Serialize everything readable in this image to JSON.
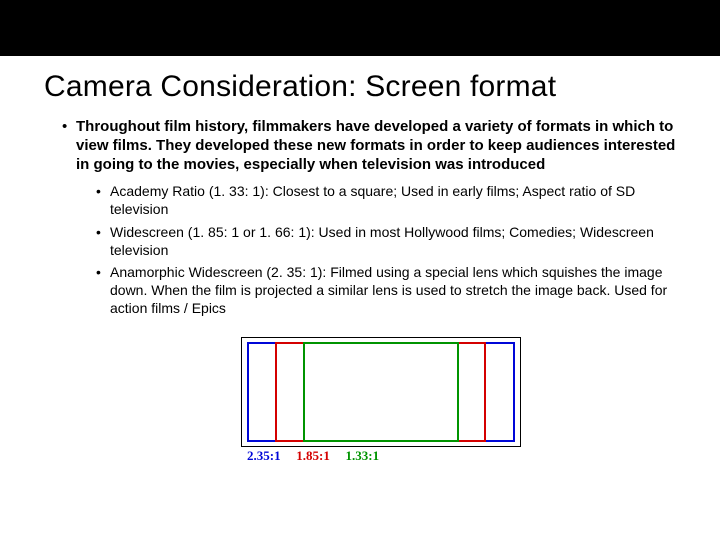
{
  "title": "Camera Consideration: Screen format",
  "intro": "Throughout film history, filmmakers have developed a variety of formats in which to view films.  They developed these new formats in order to keep audiences interested in going to the movies, especially when television was introduced",
  "bullets": [
    "Academy Ratio (1. 33: 1):  Closest to a square; Used in early films; Aspect ratio of SD television",
    "Widescreen (1. 85: 1 or 1. 66: 1): Used in most Hollywood films; Comedies; Widescreen television",
    "Anamorphic Widescreen (2. 35: 1): Filmed using a special lens which squishes the image down.  When the film is projected a similar lens is used to stretch the image back.  Used for action films / Epics"
  ],
  "diagram": {
    "labels": {
      "r235": "2.35:1",
      "r185": "1.85:1",
      "r133": "1.33:1"
    },
    "colors": {
      "r235": "#0007d8",
      "r185": "#d40000",
      "r133": "#009400"
    }
  },
  "chart_data": {
    "type": "table",
    "title": "Film aspect ratios",
    "columns": [
      "label",
      "ratio_width",
      "ratio_height",
      "color"
    ],
    "rows": [
      {
        "label": "2.35:1",
        "ratio_width": 2.35,
        "ratio_height": 1,
        "color": "#0007d8"
      },
      {
        "label": "1.85:1",
        "ratio_width": 1.85,
        "ratio_height": 1,
        "color": "#d40000"
      },
      {
        "label": "1.33:1",
        "ratio_width": 1.33,
        "ratio_height": 1,
        "color": "#009400"
      }
    ]
  }
}
